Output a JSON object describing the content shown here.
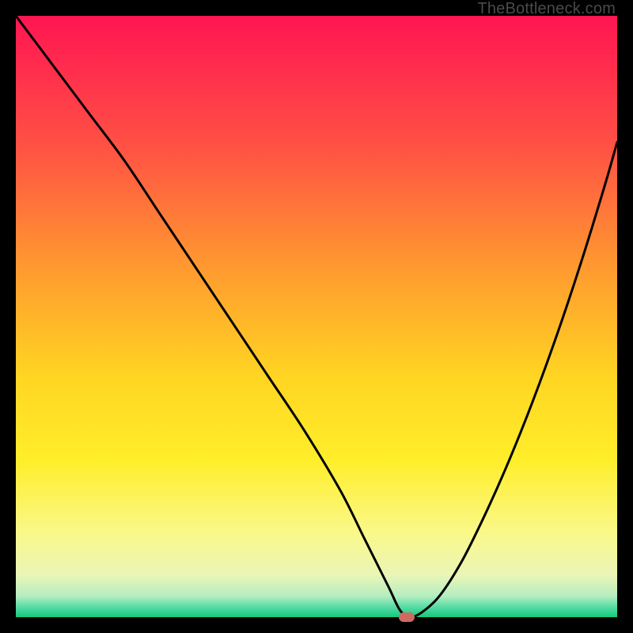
{
  "watermark": "TheBottleneck.com",
  "chart_data": {
    "type": "line",
    "title": "",
    "xlabel": "",
    "ylabel": "",
    "xlim": [
      0,
      100
    ],
    "ylim": [
      0,
      100
    ],
    "gradient_stops": [
      {
        "offset": 0.0,
        "color": "#ff1552"
      },
      {
        "offset": 0.22,
        "color": "#ff5244"
      },
      {
        "offset": 0.42,
        "color": "#ff9a2f"
      },
      {
        "offset": 0.6,
        "color": "#ffd522"
      },
      {
        "offset": 0.74,
        "color": "#ffee2a"
      },
      {
        "offset": 0.86,
        "color": "#faf88a"
      },
      {
        "offset": 0.93,
        "color": "#eaf5b6"
      },
      {
        "offset": 0.965,
        "color": "#b4eec0"
      },
      {
        "offset": 0.985,
        "color": "#4cd9a0"
      },
      {
        "offset": 1.0,
        "color": "#16c97a"
      }
    ],
    "series": [
      {
        "name": "bottleneck-curve",
        "x": [
          0,
          6,
          12,
          18,
          24,
          30,
          36,
          42,
          48,
          54,
          58,
          62,
          64,
          66,
          70,
          74,
          78,
          82,
          86,
          90,
          94,
          98,
          100
        ],
        "y": [
          100,
          92,
          84,
          76,
          67,
          58,
          49,
          40,
          31,
          21,
          13,
          5,
          1,
          0,
          3,
          9,
          17,
          26,
          36,
          47,
          59,
          72,
          79
        ]
      }
    ],
    "marker": {
      "x": 65,
      "y": 0,
      "color": "#cf6a63"
    }
  }
}
